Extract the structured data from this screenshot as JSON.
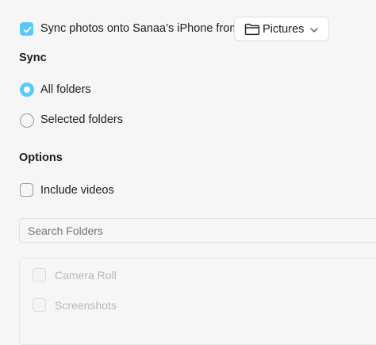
{
  "sync_option": {
    "checked": true,
    "label": "Sync photos onto Sanaa’s iPhone from:",
    "source_value": "Pictures",
    "source_icon": "folder-icon"
  },
  "sync_section": {
    "heading": "Sync",
    "options": [
      {
        "label": "All folders",
        "selected": true
      },
      {
        "label": "Selected folders",
        "selected": false
      }
    ]
  },
  "options_section": {
    "heading": "Options",
    "include_videos": {
      "label": "Include videos",
      "checked": false
    }
  },
  "search": {
    "placeholder": "Search Folders",
    "value": ""
  },
  "folders": [
    {
      "label": "Camera Roll",
      "checked": false,
      "enabled": false
    },
    {
      "label": "Screenshots",
      "checked": false,
      "enabled": false
    }
  ],
  "colors": {
    "accent": "#5ac8fa",
    "background": "#f6f6f6"
  }
}
